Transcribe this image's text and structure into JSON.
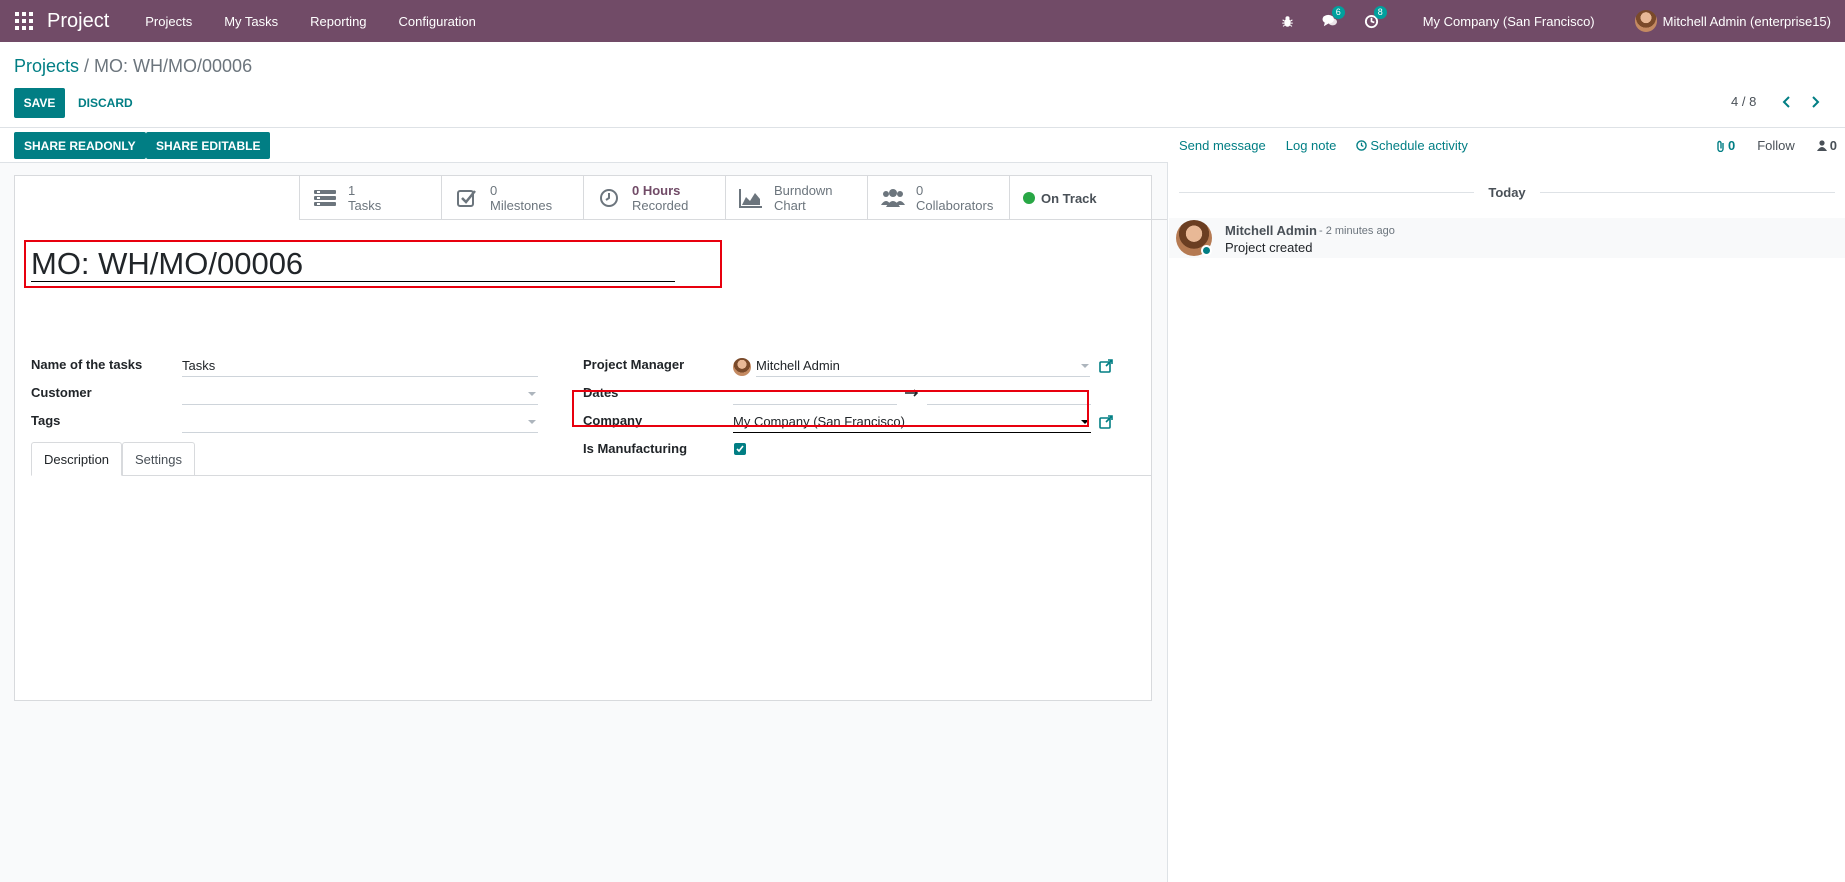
{
  "navbar": {
    "brand": "Project",
    "menu": [
      "Projects",
      "My Tasks",
      "Reporting",
      "Configuration"
    ],
    "messages_badge": "6",
    "activities_badge": "8",
    "company": "My Company (San Francisco)",
    "user": "Mitchell Admin (enterprise15)"
  },
  "control_panel": {
    "breadcrumb_parent": "Projects",
    "breadcrumb_separator": " / ",
    "breadcrumb_current": "MO: WH/MO/00006",
    "save_label": "SAVE",
    "discard_label": "DISCARD",
    "pager": "4 / 8"
  },
  "statusbar": {
    "share_readonly": "SHARE READONLY",
    "share_editable": "SHARE EDITABLE"
  },
  "stat_buttons": {
    "tasks": {
      "value": "1",
      "label": "Tasks"
    },
    "milestones": {
      "value": "0",
      "label": "Milestones"
    },
    "hours": {
      "value": "0 Hours",
      "label": "Recorded"
    },
    "burndown": {
      "value": "Burndown",
      "label": "Chart"
    },
    "collaborators": {
      "value": "0",
      "label": "Collaborators"
    },
    "status": "On Track"
  },
  "form": {
    "title": "MO: WH/MO/00006",
    "name_of_tasks_label": "Name of the tasks",
    "name_of_tasks_value": "Tasks",
    "customer_label": "Customer",
    "customer_value": "",
    "tags_label": "Tags",
    "tags_value": "",
    "project_manager_label": "Project Manager",
    "project_manager_value": "Mitchell Admin",
    "dates_label": "Dates",
    "company_label": "Company",
    "company_value": "My Company (San Francisco)",
    "is_manufacturing_label": "Is Manufacturing",
    "is_manufacturing_checked": true
  },
  "tabs": [
    "Description",
    "Settings"
  ],
  "chatter": {
    "send_message": "Send message",
    "log_note": "Log note",
    "schedule_activity": "Schedule activity",
    "attachments_count": "0",
    "follow": "Follow",
    "followers_count": "0",
    "today": "Today",
    "message": {
      "author": "Mitchell Admin",
      "date": "- 2 minutes ago",
      "body": "Project created"
    }
  }
}
